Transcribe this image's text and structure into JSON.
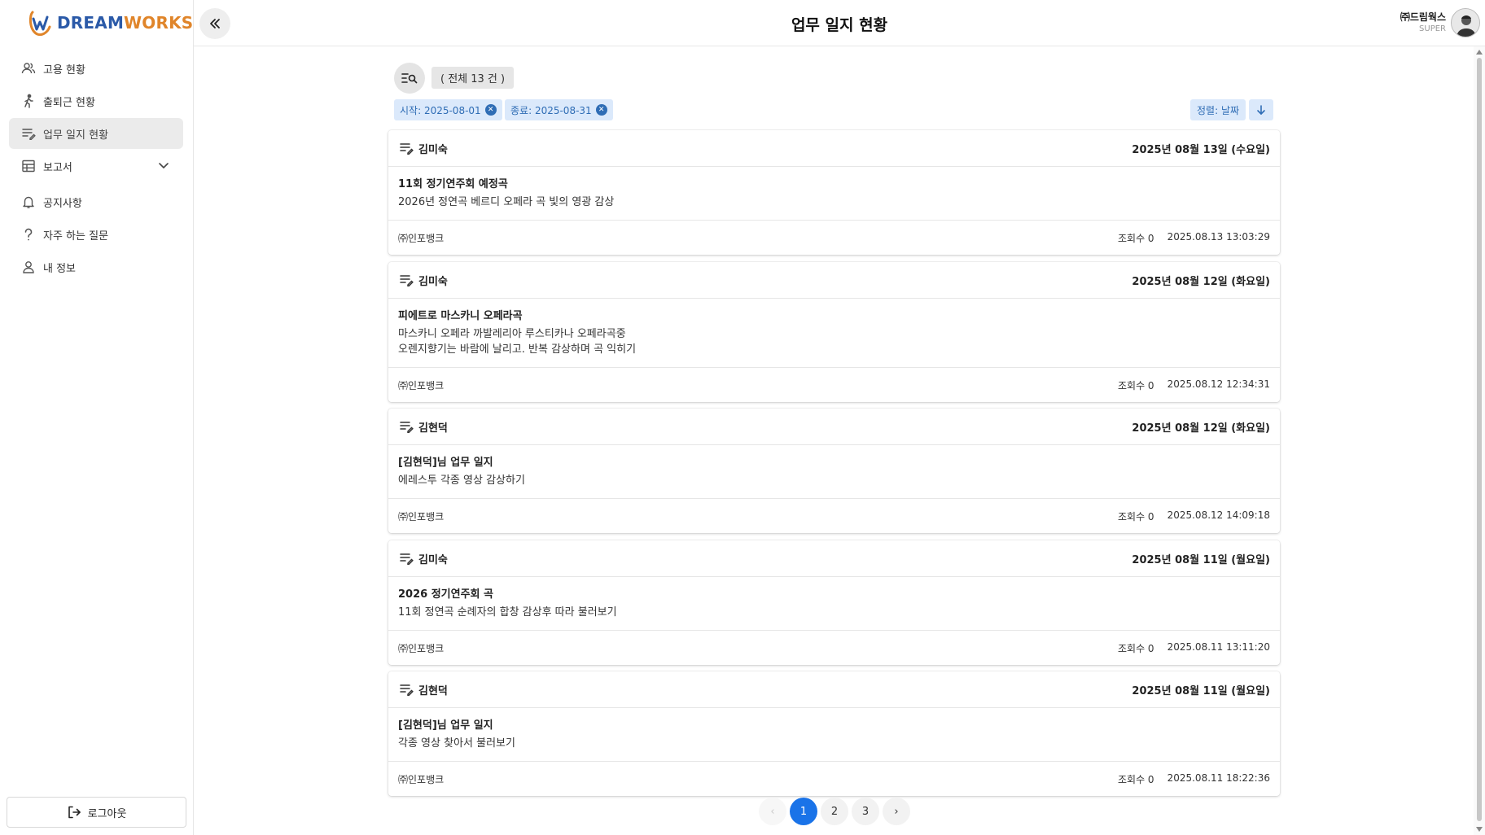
{
  "brand": {
    "part1": "DREAM",
    "part2": "WORKS"
  },
  "header": {
    "title": "업무 일지 현황",
    "company": "㈜드림웍스",
    "role": "SUPER"
  },
  "sidebar": {
    "items": [
      {
        "label": "고용 현황",
        "icon": "users-icon"
      },
      {
        "label": "출퇴근 현황",
        "icon": "walking-icon"
      },
      {
        "label": "업무 일지 현황",
        "icon": "edit-list-icon",
        "active": true
      },
      {
        "label": "보고서",
        "icon": "table-icon",
        "expandable": true
      },
      {
        "label": "공지사항",
        "icon": "bell-icon"
      },
      {
        "label": "자주 하는 질문",
        "icon": "question-icon"
      },
      {
        "label": "내 정보",
        "icon": "user-icon"
      }
    ],
    "logout_label": "로그아웃"
  },
  "toolbar": {
    "total_label": "( 전체 13 건 )",
    "filters": [
      "시작: 2025-08-01",
      "종료: 2025-08-31"
    ],
    "sort_label": "정렬: 날짜",
    "sort_direction": "descending"
  },
  "cards": [
    {
      "author": "김미숙",
      "date": "2025년 08월 13일 (수요일)",
      "title": "11회 정기연주회 예정곡",
      "content": "2026년 정연곡 베르디 오페라 곡 빛의 영광 감상",
      "company": "㈜인포뱅크",
      "views": "조회수 0",
      "timestamp": "2025.08.13 13:03:29"
    },
    {
      "author": "김미숙",
      "date": "2025년 08월 12일 (화요일)",
      "title": "피에트로 마스카니 오페라곡",
      "content": "마스카니 오페라 까발레리아 루스티카나 오페라곡중\n오렌지향기는 바람에 날리고. 반복 감상하며 곡 익히기",
      "company": "㈜인포뱅크",
      "views": "조회수 0",
      "timestamp": "2025.08.12 12:34:31"
    },
    {
      "author": "김현덕",
      "date": "2025년 08월 12일 (화요일)",
      "title": "[김현덕]님 업무 일지",
      "content": "에레스투 각종 영상 감상하기",
      "company": "㈜인포뱅크",
      "views": "조회수 0",
      "timestamp": "2025.08.12 14:09:18"
    },
    {
      "author": "김미숙",
      "date": "2025년 08월 11일 (월요일)",
      "title": "2026 정기연주회 곡",
      "content": "11회 정연곡 순례자의 합창 감상후 따라 불러보기",
      "company": "㈜인포뱅크",
      "views": "조회수 0",
      "timestamp": "2025.08.11 13:11:20"
    },
    {
      "author": "김현덕",
      "date": "2025년 08월 11일 (월요일)",
      "title": "[김현덕]님 업무 일지",
      "content": "각종 영상 찾아서 불러보기",
      "company": "㈜인포뱅크",
      "views": "조회수 0",
      "timestamp": "2025.08.11 18:22:36"
    }
  ],
  "pagination": {
    "prev": "‹",
    "pages": [
      "1",
      "2",
      "3"
    ],
    "current": "1",
    "next": "›"
  },
  "colors": {
    "accent": "#1a73e8",
    "chip_bg": "#dbe9fb",
    "chip_text": "#2f6db5",
    "brand_blue": "#2b5aa8",
    "brand_orange": "#e0852a"
  }
}
